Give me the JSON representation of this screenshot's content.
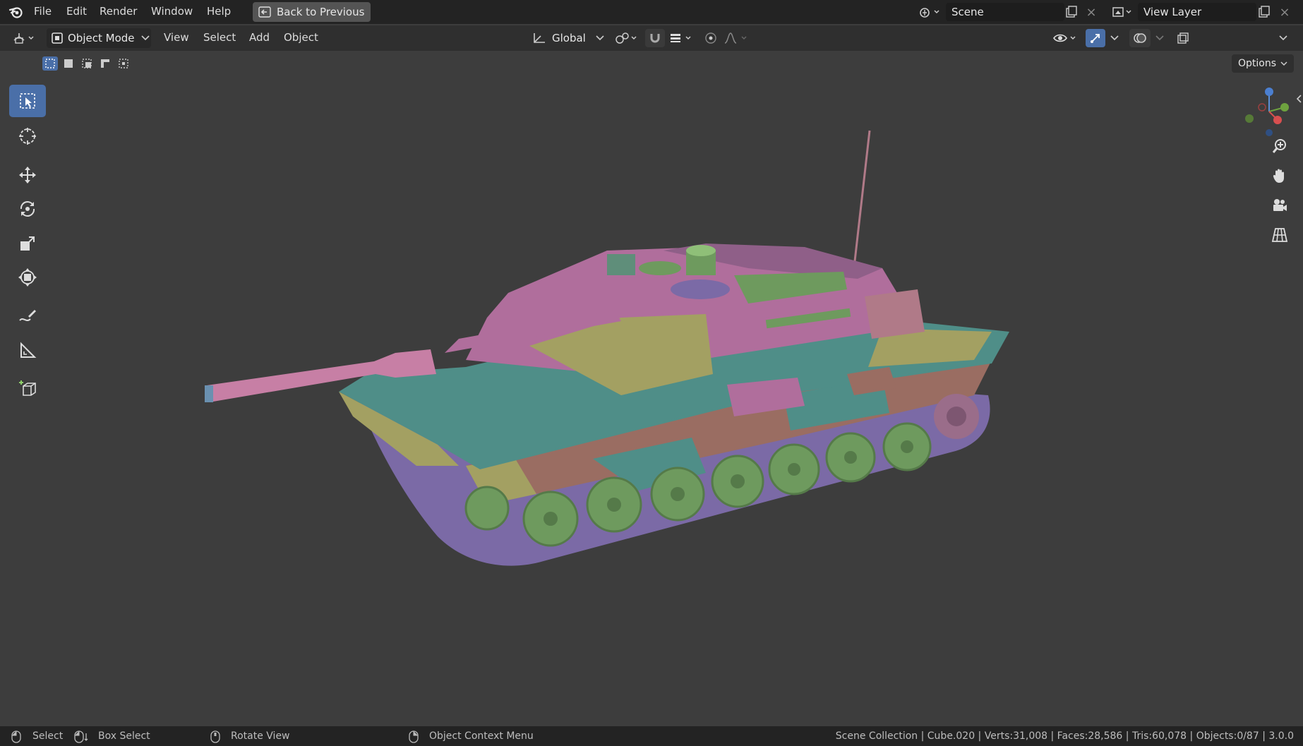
{
  "topbar": {
    "menus": [
      "File",
      "Edit",
      "Render",
      "Window",
      "Help"
    ],
    "back_label": "Back to Previous",
    "scene_name": "Scene",
    "view_layer_name": "View Layer",
    "icons": {
      "blender": "blender-logo-icon",
      "back": "back-arrow-icon"
    }
  },
  "header": {
    "mode_label": "Object Mode",
    "menus": [
      "View",
      "Select",
      "Add",
      "Object"
    ],
    "orientation_label": "Global",
    "options_label": "Options"
  },
  "toolbar": {
    "tools": [
      "select-box",
      "cursor",
      "move",
      "rotate",
      "scale",
      "transform",
      "annotate",
      "measure",
      "add-cube"
    ],
    "active_tool": "select-box"
  },
  "status": {
    "select": "Select",
    "box_select": "Box Select",
    "rotate_view": "Rotate View",
    "context_menu": "Object Context Menu",
    "stats": "Scene Collection | Cube.020 | Verts:31,008 | Faces:28,586 | Tris:60,078 | Objects:0/87 | 3.0.0"
  },
  "colors": {
    "accent": "#4a6fa8",
    "viewport_bg": "#3d3d3d",
    "topbar_bg": "#232323",
    "tank_pink": "#b06e9c",
    "tank_teal": "#4f8e88",
    "tank_olive": "#a3a062",
    "tank_green": "#6e9a5e",
    "tank_purple": "#7b6aa6",
    "tank_brown": "#9a6d62"
  }
}
